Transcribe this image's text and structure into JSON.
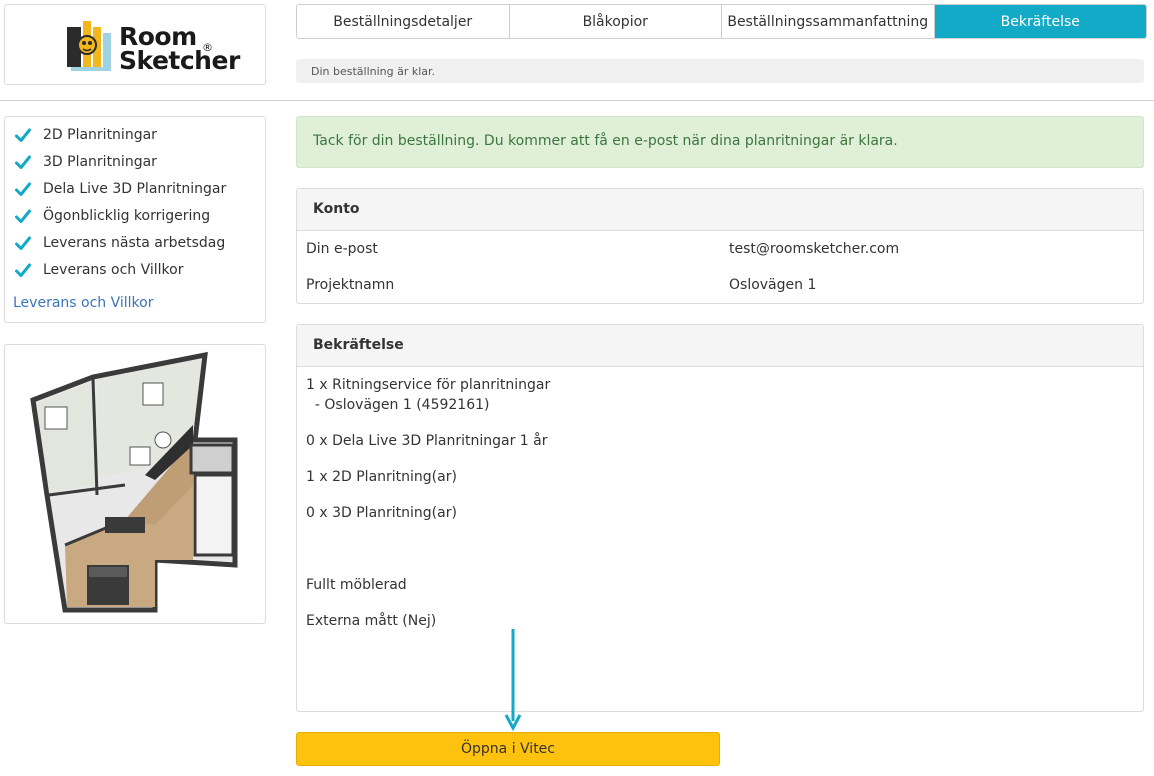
{
  "brand": {
    "line1": "Room",
    "line2": "Sketcher",
    "reg": "®"
  },
  "tabs": [
    {
      "label": "Beställningsdetaljer",
      "active": false
    },
    {
      "label": "Blåkopior",
      "active": false
    },
    {
      "label": "Beställningssammanfattning",
      "active": false
    },
    {
      "label": "Bekräftelse",
      "active": true
    }
  ],
  "status": "Din beställning är klar.",
  "features": {
    "items": [
      "2D Planritningar",
      "3D Planritningar",
      "Dela Live 3D Planritningar",
      "Ögonblicklig korrigering",
      "Leverans nästa arbetsdag",
      "Leverans och Villkor"
    ],
    "link": "Leverans och Villkor"
  },
  "alert": "Tack för din beställning. Du kommer att få en e-post när dina planritningar är klara.",
  "account": {
    "title": "Konto",
    "rows": [
      {
        "label": "Din e-post",
        "value": "test@roomsketcher.com"
      },
      {
        "label": "Projektnamn",
        "value": "Oslovägen 1"
      }
    ]
  },
  "confirmation": {
    "title": "Bekräftelse",
    "lines": [
      "1 x Ritningservice för planritningar",
      "  - Oslovägen 1 (4592161)",
      "0 x Dela Live 3D Planritningar 1 år",
      "1 x 2D Planritning(ar)",
      "0 x 3D Planritning(ar)",
      "Fullt möblerad",
      "Externa mått (Nej)"
    ]
  },
  "button": "Öppna i Vitec",
  "colors": {
    "accent": "#12aac6",
    "button": "#ffc20e",
    "alert_bg": "#dfefd8",
    "alert_text": "#3c763d",
    "link": "#3a74b8"
  }
}
